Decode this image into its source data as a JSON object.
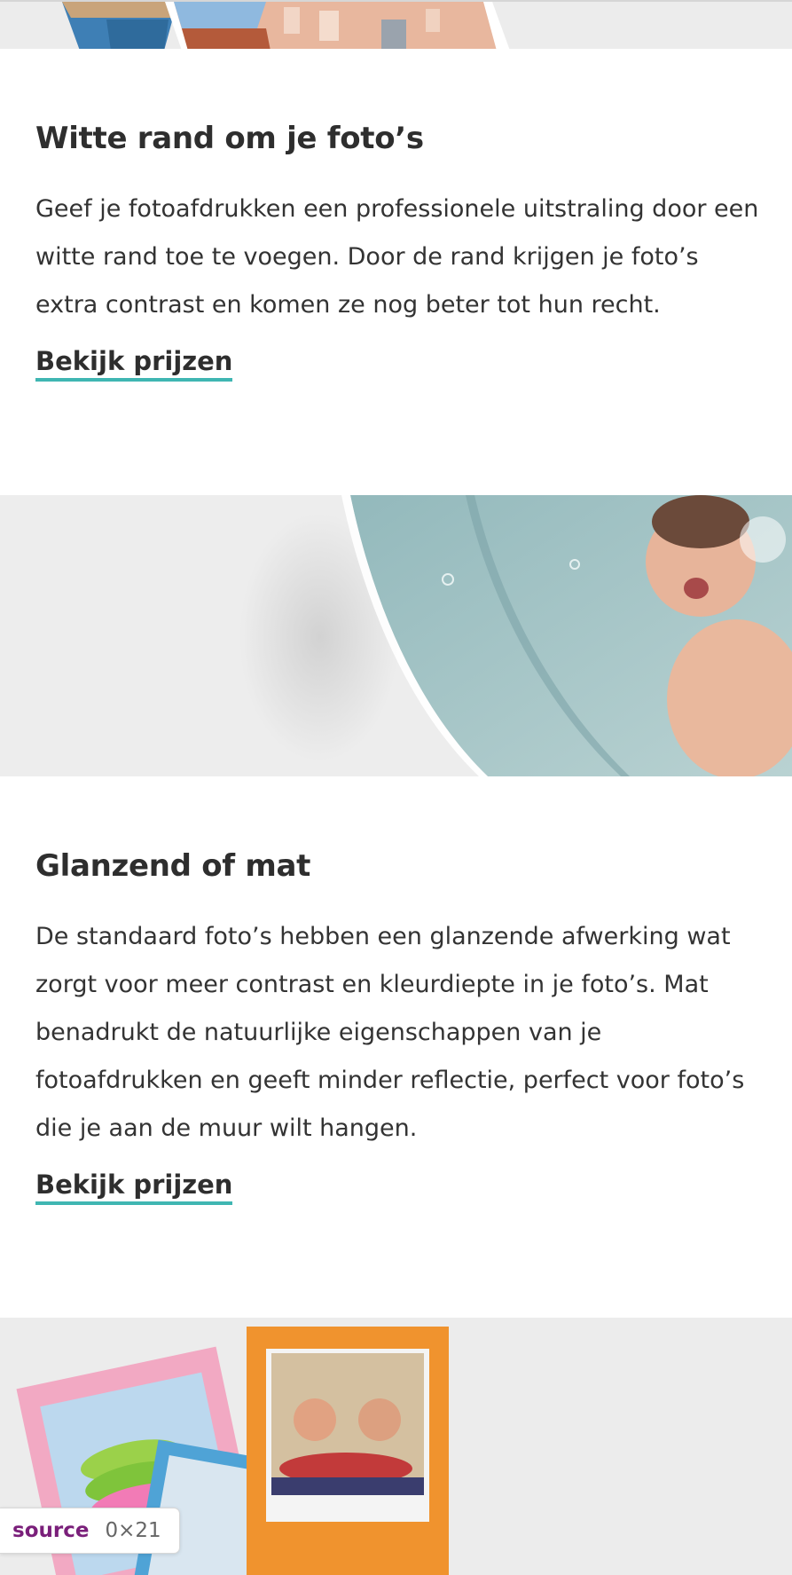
{
  "sections": [
    {
      "heading": "Witte rand om je foto’s",
      "body": "Geef je fotoafdrukken een professionele uitstraling door een witte rand toe te voegen. Door de rand krijgen je foto’s extra contrast en komen ze nog beter tot hun recht.",
      "link": "Bekijk prijzen"
    },
    {
      "heading": "Glanzend of mat",
      "body": "De standaard foto’s hebben een glanzende afwerking wat zorgt voor meer contrast en kleurdiepte in je foto’s. Mat benadrukt de natuurlijke eigenschappen van je fotoafdrukken en geeft minder reflectie, perfect voor foto’s die je aan de muur wilt hangen.",
      "link": "Bekijk prijzen"
    }
  ],
  "badge": {
    "label": "source",
    "dims": "0×21"
  },
  "colors": {
    "link_underline": "#3fb6b2",
    "band_background": "#ededed",
    "text": "#333333"
  },
  "images": {
    "top": "photo-prints-houses",
    "middle": "glossy-print-baby-bath",
    "bottom": "colored-frame-prints"
  }
}
